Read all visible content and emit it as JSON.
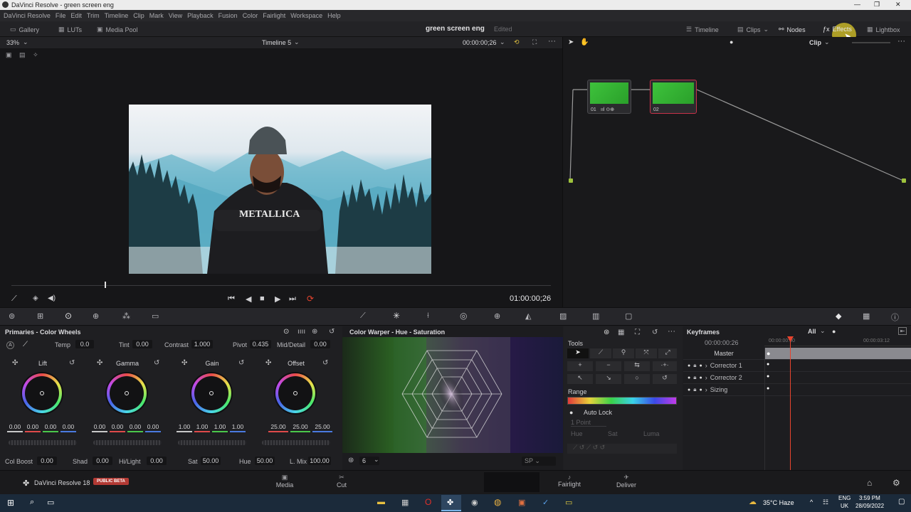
{
  "window": {
    "title": "DaVinci Resolve - green screen eng"
  },
  "menu": [
    "DaVinci Resolve",
    "File",
    "Edit",
    "Trim",
    "Timeline",
    "Clip",
    "Mark",
    "View",
    "Playback",
    "Fusion",
    "Color",
    "Fairlight",
    "Workspace",
    "Help"
  ],
  "toolbar": {
    "left": [
      "Gallery",
      "LUTs",
      "Media Pool"
    ],
    "project_name": "green screen eng",
    "project_status": "Edited",
    "right": [
      "Timeline",
      "Clips",
      "Nodes",
      "Effects",
      "Lightbox"
    ]
  },
  "viewer": {
    "zoom": "33%",
    "timeline_name": "Timeline 5",
    "timecode_top": "00:00:00;26",
    "timecode_bottom": "01:00:00;26"
  },
  "nodes": {
    "mode": "Clip",
    "node1_label": "01",
    "node2_label": "02"
  },
  "primaries": {
    "title": "Primaries - Color Wheels",
    "temp_label": "Temp",
    "temp": "0.0",
    "tint_label": "Tint",
    "tint": "0.00",
    "contrast_label": "Contrast",
    "contrast": "1.000",
    "pivot_label": "Pivot",
    "pivot": "0.435",
    "middetail_label": "Mid/Detail",
    "middetail": "0.00",
    "wheels": [
      {
        "name": "Lift",
        "values": [
          "0.00",
          "0.00",
          "0.00",
          "0.00"
        ]
      },
      {
        "name": "Gamma",
        "values": [
          "0.00",
          "0.00",
          "0.00",
          "0.00"
        ]
      },
      {
        "name": "Gain",
        "values": [
          "1.00",
          "1.00",
          "1.00",
          "1.00"
        ]
      },
      {
        "name": "Offset",
        "values": [
          "25.00",
          "25.00",
          "25.00"
        ]
      }
    ],
    "bottom": [
      {
        "label": "Col Boost",
        "value": "0.00"
      },
      {
        "label": "Shad",
        "value": "0.00"
      },
      {
        "label": "Hi/Light",
        "value": "0.00"
      },
      {
        "label": "Sat",
        "value": "50.00"
      },
      {
        "label": "Hue",
        "value": "50.00"
      },
      {
        "label": "L. Mix",
        "value": "100.00"
      }
    ]
  },
  "warper": {
    "title": "Color Warper - Hue - Saturation",
    "resolution": "6"
  },
  "tools": {
    "title": "Tools",
    "range_label": "Range",
    "autolock_label": "Auto Lock",
    "point_select": "1 Point",
    "hue_label": "Hue",
    "sat_label": "Sat",
    "luma_label": "Luma"
  },
  "keyframes": {
    "title": "Keyframes",
    "filter": "All",
    "timecode": "00:00:00:26",
    "ruler_start": "00:00:00:00",
    "ruler_end": "00:00:03:12",
    "tracks": [
      "Master",
      "Corrector 1",
      "Corrector 2",
      "Sizing"
    ]
  },
  "app": {
    "name": "DaVinci Resolve 18",
    "badge": "PUBLIC BETA",
    "pages": [
      "Media",
      "Cut",
      "Fairlight",
      "Deliver"
    ]
  },
  "taskbar": {
    "weather": "35°C Haze",
    "lang": "ENG",
    "region": "UK",
    "time": "3:59 PM",
    "date": "28/09/2022"
  },
  "colors": {
    "accent": "#e8442e",
    "node_border": "#c8324a",
    "badge": "#b33a34"
  }
}
